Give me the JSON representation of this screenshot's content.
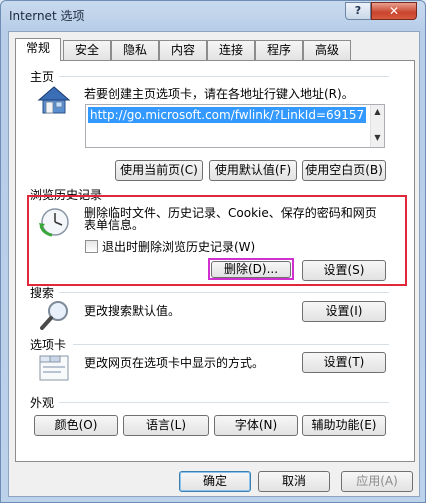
{
  "window": {
    "title": "Internet 选项",
    "help_label": "?",
    "close_label": "✕"
  },
  "tabs": [
    {
      "label": "常规",
      "active": true
    },
    {
      "label": "安全"
    },
    {
      "label": "隐私"
    },
    {
      "label": "内容"
    },
    {
      "label": "连接"
    },
    {
      "label": "程序"
    },
    {
      "label": "高级"
    }
  ],
  "home": {
    "label": "主页",
    "description": "若要创建主页选项卡，请在各地址行键入地址(R)。",
    "url": "http://go.microsoft.com/fwlink/?LinkId=69157",
    "use_current": "使用当前页(C)",
    "use_default": "使用默认值(F)",
    "use_blank": "使用空白页(B)"
  },
  "history": {
    "label": "浏览历史记录",
    "description_line1": "删除临时文件、历史记录、Cookie、保存的密码和网页",
    "description_line2": "表单信息。",
    "checkbox_label": "退出时删除浏览历史记录(W)",
    "checkbox_checked": false,
    "delete_label": "删除(D)...",
    "settings_label": "设置(S)"
  },
  "search": {
    "label": "搜索",
    "description": "更改搜索默认值。",
    "settings_label": "设置(I)"
  },
  "tabs_section": {
    "label": "选项卡",
    "description": "更改网页在选项卡中显示的方式。",
    "settings_label": "设置(T)"
  },
  "appearance": {
    "label": "外观",
    "colors": "颜色(O)",
    "languages": "语言(L)",
    "fonts": "字体(N)",
    "accessibility": "辅助功能(E)"
  },
  "footer": {
    "ok": "确定",
    "cancel": "取消",
    "apply": "应用(A)"
  },
  "colors": {
    "highlight_red": "#e0283a",
    "highlight_magenta": "#d030d0",
    "selection_blue": "#3399ff"
  },
  "icons": [
    "house-icon",
    "clock-refresh-icon",
    "magnifier-icon",
    "tabs-window-icon"
  ]
}
